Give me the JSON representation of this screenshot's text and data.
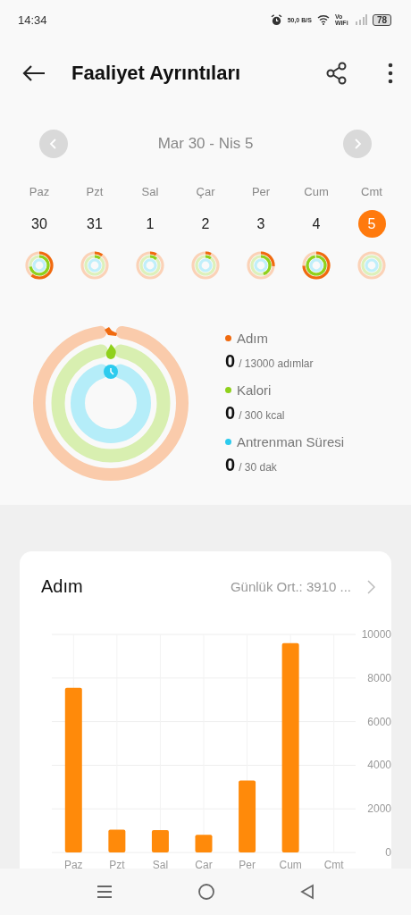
{
  "status_bar": {
    "time": "14:34",
    "speed": "50,0",
    "speed_unit": "B/S",
    "vowifi": "Vo WiFi",
    "battery": "78"
  },
  "header": {
    "title": "Faaliyet Ayrıntıları"
  },
  "week": {
    "range": "Mar 30 - Nis 5",
    "days": [
      {
        "weekday": "Paz",
        "date": "30",
        "selected": false
      },
      {
        "weekday": "Pzt",
        "date": "31",
        "selected": false
      },
      {
        "weekday": "Sal",
        "date": "1",
        "selected": false
      },
      {
        "weekday": "Çar",
        "date": "2",
        "selected": false
      },
      {
        "weekday": "Per",
        "date": "3",
        "selected": false
      },
      {
        "weekday": "Cum",
        "date": "4",
        "selected": false
      },
      {
        "weekday": "Cmt",
        "date": "5",
        "selected": true
      }
    ]
  },
  "summary": {
    "metrics": [
      {
        "kind": "steps",
        "label": "Adım",
        "value": "0",
        "goal": "/ 13000 adımlar",
        "color": "#f06a0f"
      },
      {
        "kind": "calories",
        "label": "Kalori",
        "value": "0",
        "goal": "/ 300 kcal",
        "color": "#8fd11c"
      },
      {
        "kind": "exercise",
        "label": "Antrenman Süresi",
        "value": "0",
        "goal": "/ 30 dak",
        "color": "#2ccbee"
      }
    ]
  },
  "steps_card": {
    "title": "Adım",
    "average": "Günlük Ort.: 3910 ...",
    "chart_data": {
      "type": "bar",
      "categories": [
        "Paz",
        "Pzt",
        "Sal",
        "Car",
        "Per",
        "Cum",
        "Cmt"
      ],
      "grid": true,
      "series": [
        {
          "color": "#ff8a0a",
          "values": [
            7550,
            1050,
            1020,
            810,
            3300,
            9600,
            0
          ]
        }
      ],
      "ylim": [
        0,
        10000
      ],
      "yticks": [
        0,
        2000,
        4000,
        6000,
        8000,
        10000
      ]
    }
  }
}
